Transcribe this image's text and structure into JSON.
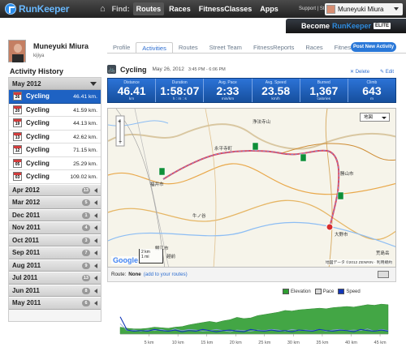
{
  "topbar": {
    "app_title": "RunKeeper",
    "home_icon": "home-icon",
    "find_label": "Find:",
    "nav": [
      "Routes",
      "Races",
      "FitnessClasses",
      "Apps"
    ],
    "support_store": "Support | Store",
    "user_name": "Muneyuki Miura"
  },
  "banner": {
    "become": "Become",
    "brand": "RunKeeper",
    "elite": "ELITE"
  },
  "profile": {
    "name": "Muneyuki Miura",
    "location": "kijiya"
  },
  "tabs": [
    "Profile",
    "Activities",
    "Routes",
    "Street Team",
    "FitnessReports",
    "Races",
    "FitnessClasses"
  ],
  "post_button": "Post New Activity",
  "sidebar": {
    "title": "Activity History",
    "open_month": "May 2012",
    "activities": [
      {
        "day": "26",
        "name": "Cycling",
        "distance": "46.41 km.",
        "selected": true
      },
      {
        "day": "20",
        "name": "Cycling",
        "distance": "41.59 km."
      },
      {
        "day": "19",
        "name": "Cycling",
        "distance": "44.13 km."
      },
      {
        "day": "13",
        "name": "Cycling",
        "distance": "42.62 km."
      },
      {
        "day": "12",
        "name": "Cycling",
        "distance": "71.15 km."
      },
      {
        "day": "05",
        "name": "Cycling",
        "distance": "25.29 km."
      },
      {
        "day": "03",
        "name": "Cycling",
        "distance": "109.02 km."
      }
    ],
    "collapsed_months": [
      {
        "label": "Apr 2012",
        "count": "13"
      },
      {
        "label": "Mar 2012",
        "count": "5"
      },
      {
        "label": "Dec 2011",
        "count": "1"
      },
      {
        "label": "Nov 2011",
        "count": "4"
      },
      {
        "label": "Oct 2011",
        "count": "3"
      },
      {
        "label": "Sep 2011",
        "count": "7"
      },
      {
        "label": "Aug 2011",
        "count": "9"
      },
      {
        "label": "Jul 2011",
        "count": "13"
      },
      {
        "label": "Jun 2011",
        "count": "8"
      },
      {
        "label": "May 2011",
        "count": "6"
      }
    ]
  },
  "activity": {
    "icon": "cycling-icon",
    "title": "Cycling",
    "date": "May 26, 2012",
    "time": "3:45 PM - 6:06 PM",
    "delete": "Delete",
    "edit": "Edit",
    "stats": [
      {
        "label": "Distance",
        "value": "46.41",
        "unit": "km"
      },
      {
        "label": "Duration",
        "value": "1:58:07",
        "unit": "h : m : s"
      },
      {
        "label": "Avg. Pace",
        "value": "2:33",
        "unit": "min/km"
      },
      {
        "label": "Avg. Speed",
        "value": "23.58",
        "unit": "km/h"
      },
      {
        "label": "Burned",
        "value": "1,367",
        "unit": "calories"
      },
      {
        "label": "Climb",
        "value": "643",
        "unit": "m"
      }
    ]
  },
  "map": {
    "type_label": "地図",
    "labels": [
      "浄法寺山",
      "勝山市",
      "大野市",
      "福井市",
      "鯖江市",
      "牛ノ谷",
      "越前",
      "荒島岳",
      "永平寺町"
    ],
    "google": "Google",
    "scale": [
      "2 km",
      "1 mi"
    ],
    "credit": "地図データ ©2012 ZENRIN · 利用規約"
  },
  "route": {
    "label": "Route:",
    "value": "None",
    "link": "(add to your routes)"
  },
  "chart_data": {
    "type": "area",
    "series": [
      {
        "name": "Elevation",
        "color": "#2f9d31",
        "values": [
          12,
          10,
          9,
          9,
          10,
          12,
          11,
          10,
          12,
          13,
          16,
          18,
          20,
          22,
          20,
          23,
          25,
          29,
          27,
          28,
          32,
          34,
          36,
          38,
          41,
          40,
          42,
          43,
          44,
          45,
          44,
          46,
          47,
          48,
          47,
          49,
          51,
          50,
          52,
          51
        ]
      },
      {
        "name": "Pace",
        "color": "#8aa7da",
        "values": [
          18,
          6,
          7,
          5,
          7,
          6,
          8,
          5,
          9,
          6,
          8,
          7,
          5,
          6,
          8,
          6,
          4,
          7,
          6,
          5,
          7,
          6,
          8,
          7,
          5,
          8,
          6,
          7,
          6,
          8,
          5,
          7,
          8,
          6,
          7,
          6,
          9,
          5,
          8,
          6
        ]
      },
      {
        "name": "Speed",
        "color": "#1237b8",
        "values": [
          30,
          7,
          5,
          6,
          5,
          8,
          6,
          5,
          7,
          4,
          6,
          5,
          8,
          6,
          4,
          6,
          7,
          5,
          4,
          8,
          6,
          5,
          7,
          5,
          6,
          4,
          7,
          6,
          5,
          8,
          6,
          5,
          7,
          6,
          4,
          8,
          6,
          5,
          7,
          5
        ]
      }
    ],
    "x_ticks": [
      "5 km",
      "10 km",
      "15 km",
      "20 km",
      "25 km",
      "30 km",
      "35 km",
      "40 km",
      "45 km"
    ],
    "x_range": [
      0,
      46.41
    ]
  }
}
